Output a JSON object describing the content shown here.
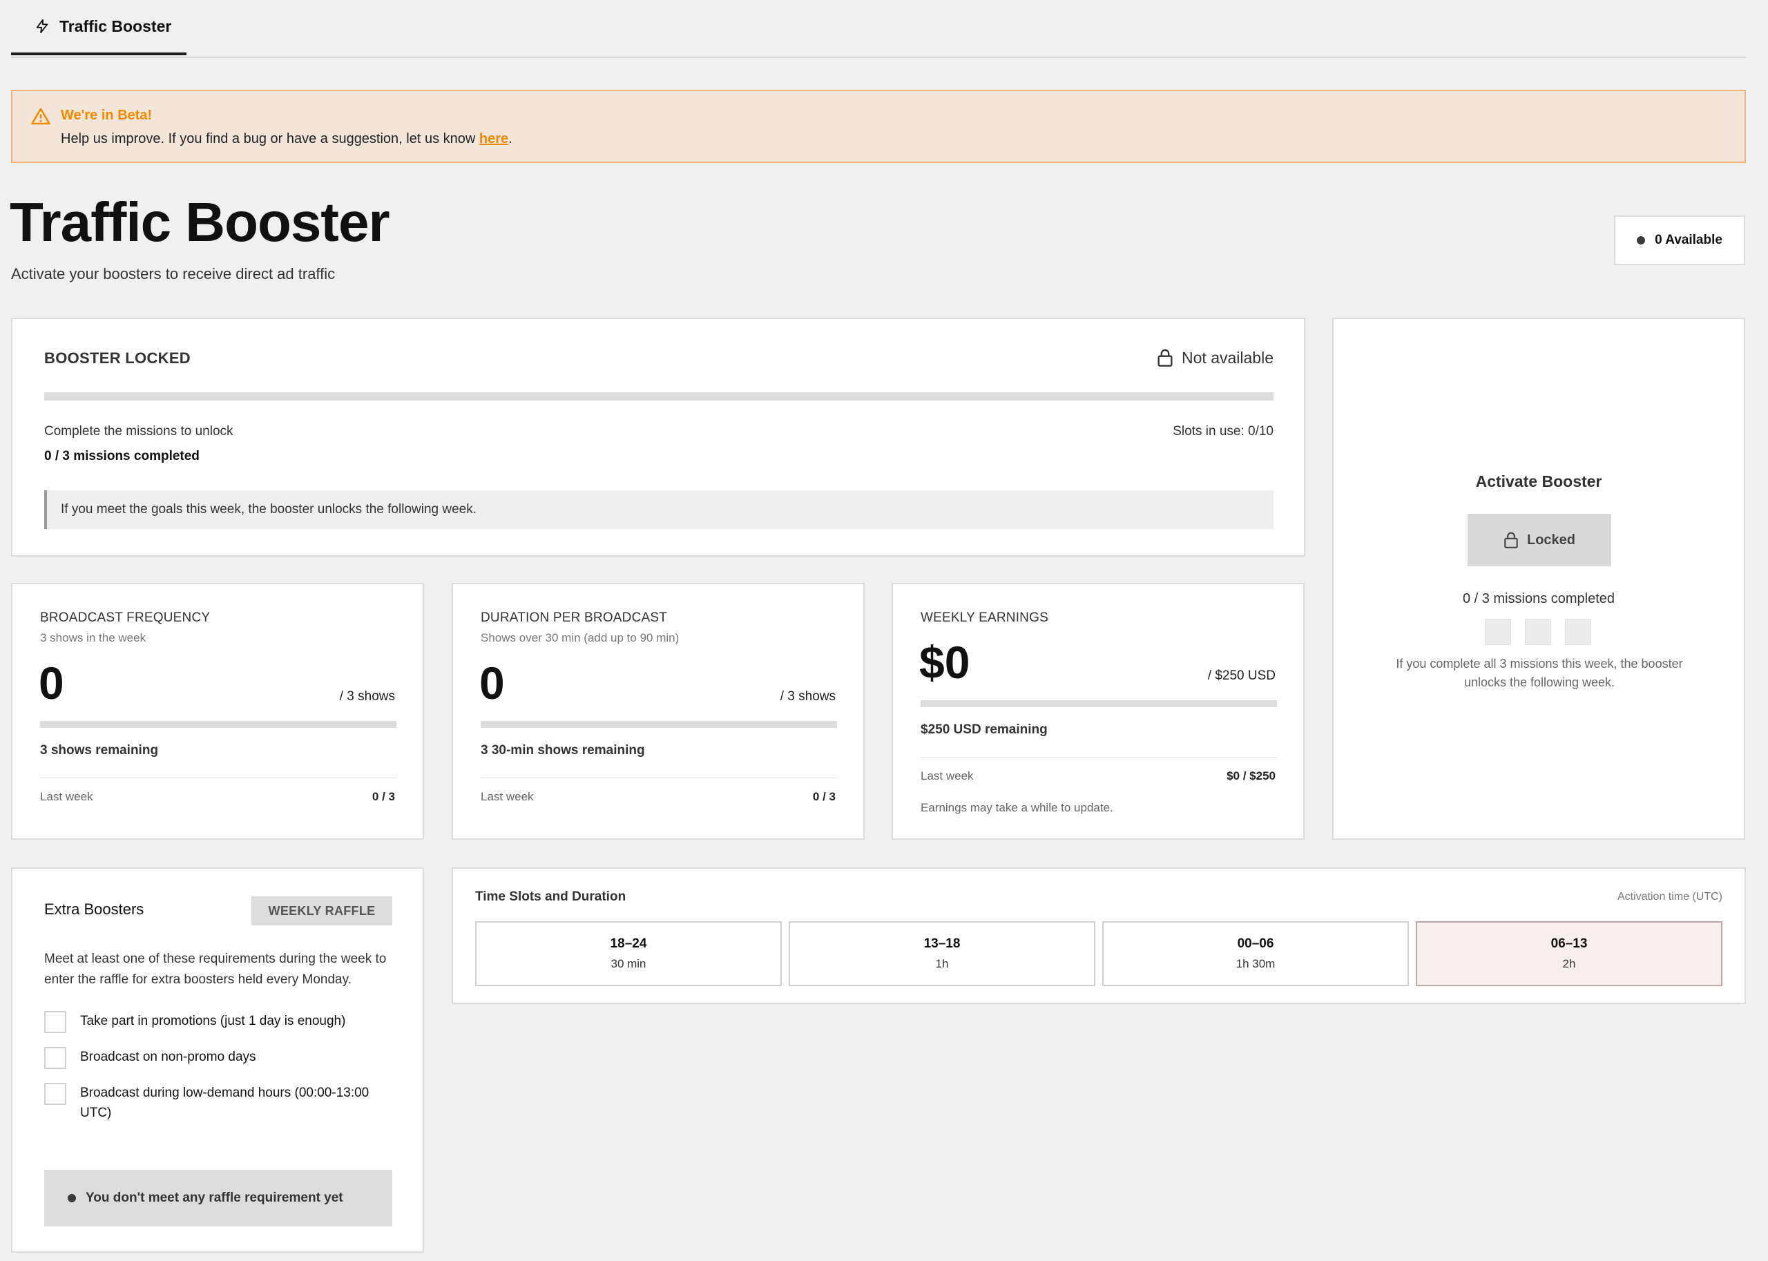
{
  "tab": {
    "label": "Traffic Booster",
    "icon": "lightning-icon"
  },
  "banner": {
    "title": "We're in Beta!",
    "text_before": "Help us improve. If you find a bug or have a suggestion, let us know ",
    "link": "here",
    "text_after": ".",
    "accent_color": "#f28a00"
  },
  "header": {
    "title": "Traffic Booster",
    "subtitle": "Activate your boosters to receive direct ad traffic",
    "available": "0 Available"
  },
  "locked": {
    "title": "BOOSTER LOCKED",
    "status": "Not available",
    "progress": 0,
    "unlock_text": "Complete the missions to unlock",
    "missions": "0 / 3 missions completed",
    "slots": "Slots in use: 0/10",
    "note": "If you meet the goals this week, the booster unlocks the following week."
  },
  "activate": {
    "title": "Activate Booster",
    "button": "Locked",
    "missions": "0 / 3 missions completed",
    "note": "If you complete all 3 missions this week, the booster unlocks the following week."
  },
  "stats": [
    {
      "title": "BROADCAST FREQUENCY",
      "subtitle": "3 shows in the week",
      "value": "0",
      "of": "/ 3 shows",
      "progress": 0,
      "remaining": "3 shows remaining",
      "last_week_label": "Last week",
      "last_week_value": "0 / 3"
    },
    {
      "title": "DURATION PER BROADCAST",
      "subtitle": "Shows over 30 min (add up to 90 min)",
      "value": "0",
      "of": "/ 3 shows",
      "progress": 0,
      "remaining": "3 30-min shows remaining",
      "last_week_label": "Last week",
      "last_week_value": "0 / 3"
    },
    {
      "title": "WEEKLY EARNINGS",
      "value": "$0",
      "of": "/ $250 USD",
      "progress": 0,
      "remaining": "$250 USD remaining",
      "last_week_label": "Last week",
      "last_week_value": "$0 / $250",
      "footnote": "Earnings may take a while to update."
    }
  ],
  "extra": {
    "title": "Extra Boosters",
    "badge": "WEEKLY RAFFLE",
    "description": "Meet at least one of these requirements during the week to enter the raffle for extra boosters held every Monday.",
    "items": [
      {
        "label": "Take part in promotions (just 1 day is enough)",
        "checked": false
      },
      {
        "label": "Broadcast on non-promo days",
        "checked": false
      },
      {
        "label": "Broadcast during low-demand hours (00:00-13:00 UTC)",
        "checked": false
      }
    ],
    "status": "You don't meet any raffle requirement yet"
  },
  "timeslots": {
    "title": "Time Slots and Duration",
    "meta": "Activation time (UTC)",
    "slots": [
      {
        "range": "18–24",
        "duration": "30 min",
        "selected": false
      },
      {
        "range": "13–18",
        "duration": "1h",
        "selected": false
      },
      {
        "range": "00–06",
        "duration": "1h 30m",
        "selected": false
      },
      {
        "range": "06–13",
        "duration": "2h",
        "selected": true
      }
    ]
  }
}
